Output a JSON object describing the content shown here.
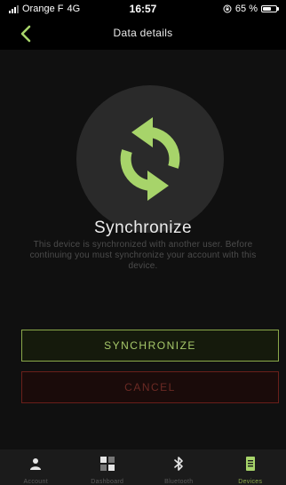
{
  "status_bar": {
    "carrier": "Orange F",
    "network": "4G",
    "time": "16:57",
    "battery_text": "65 %",
    "battery_level": 0.65
  },
  "nav": {
    "title": "Data details",
    "back_icon": "chevron-left-icon"
  },
  "sync": {
    "icon": "sync-icon",
    "title": "Synchronize",
    "description": "This device is synchronized with another user. Before continuing you must synchronize your account with this device."
  },
  "buttons": {
    "synchronize": "SYNCHRONIZE",
    "cancel": "CANCEL"
  },
  "tabs": [
    {
      "label": "Account",
      "icon": "person-icon",
      "active": false
    },
    {
      "label": "Dashboard",
      "icon": "dashboard-icon",
      "active": false
    },
    {
      "label": "Bluetooth",
      "icon": "bluetooth-icon",
      "active": false
    },
    {
      "label": "Devices",
      "icon": "device-icon",
      "active": true
    }
  ],
  "colors": {
    "accent": "#a7d46a",
    "cancel": "#6a1f1a",
    "background": "#000000"
  }
}
